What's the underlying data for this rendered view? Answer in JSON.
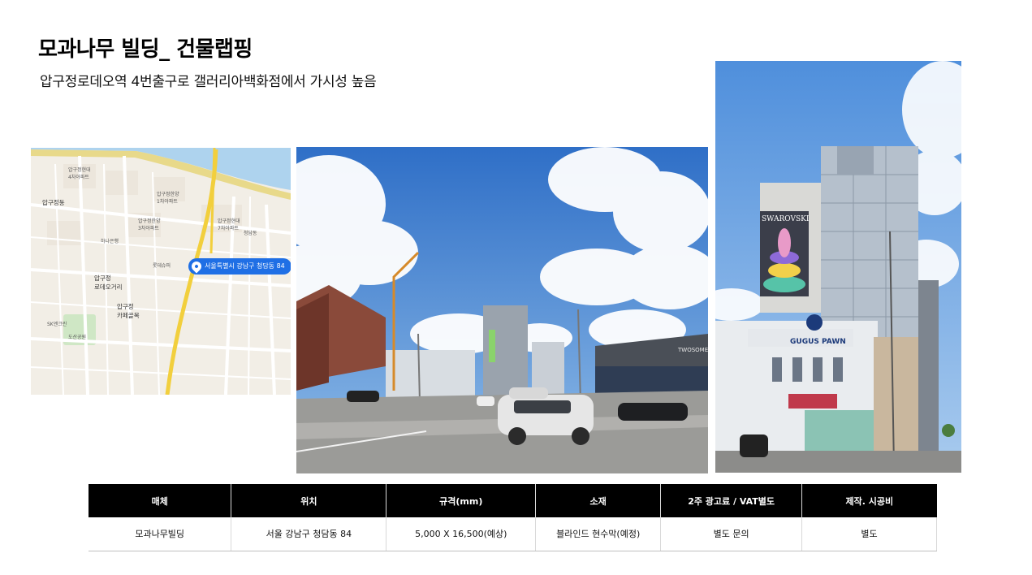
{
  "page": {
    "title": "모과나무 빌딩_ 건물랩핑",
    "subtitle": "압구정로데오역 4번출구로 갤러리아백화점에서 가시성 높음"
  },
  "map": {
    "pin_label": "서울특별시 강남구 청담동 84",
    "labels": [
      "압구정동",
      "압구정\n로데오거리",
      "압구정\n카페골목",
      "하나은행",
      "도산공원",
      "SK엔크린",
      "롯데슈퍼",
      "압구정현대\n4차아파트",
      "압구정한양\n1차아파트",
      "압구정한양\n3차아파트",
      "압구정현대\n7차아파트",
      "청담동"
    ]
  },
  "photos": {
    "street_sign": "TWOSOME",
    "building_sign_1": "SWAROVSKI",
    "building_sign_2": "GUGUS PAWN"
  },
  "table": {
    "headers": [
      "매체",
      "위치",
      "규격(mm)",
      "소재",
      "2주 광고료 / VAT별도",
      "제작. 시공비"
    ],
    "rows": [
      [
        "모과나무빌딩",
        "서울 강남구 청담동 84",
        "5,000 X 16,500(예상)",
        "블라인드 현수막(예정)",
        "별도 문의",
        "별도"
      ]
    ]
  }
}
